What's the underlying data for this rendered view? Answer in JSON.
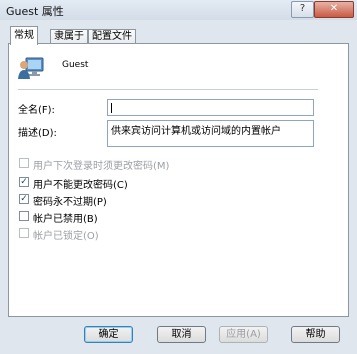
{
  "window": {
    "title": "Guest 属性",
    "help_glyph": "?",
    "close_glyph": "✕"
  },
  "tabs": [
    {
      "label": "常规"
    },
    {
      "label": "隶属于"
    },
    {
      "label": "配置文件"
    }
  ],
  "user": {
    "name": "Guest",
    "icon": "user-monitor-icon"
  },
  "fields": {
    "fullname_label": "全名(F):",
    "fullname_value": "",
    "description_label": "描述(D):",
    "description_value": "供来宾访问计算机或访问域的内置帐户"
  },
  "checkboxes": [
    {
      "label": "用户下次登录时须更改密码(M)",
      "checked": false,
      "disabled": true
    },
    {
      "label": "用户不能更改密码(C)",
      "checked": true,
      "disabled": false
    },
    {
      "label": "密码永不过期(P)",
      "checked": true,
      "disabled": false
    },
    {
      "label": "帐户已禁用(B)",
      "checked": false,
      "disabled": false
    },
    {
      "label": "帐户已锁定(O)",
      "checked": false,
      "disabled": true
    }
  ],
  "buttons": {
    "ok": "确定",
    "cancel": "取消",
    "apply": "应用(A)",
    "help": "帮助"
  },
  "colors": {
    "accent": "#3c7fb1",
    "checkmark": "#2b3f62"
  }
}
